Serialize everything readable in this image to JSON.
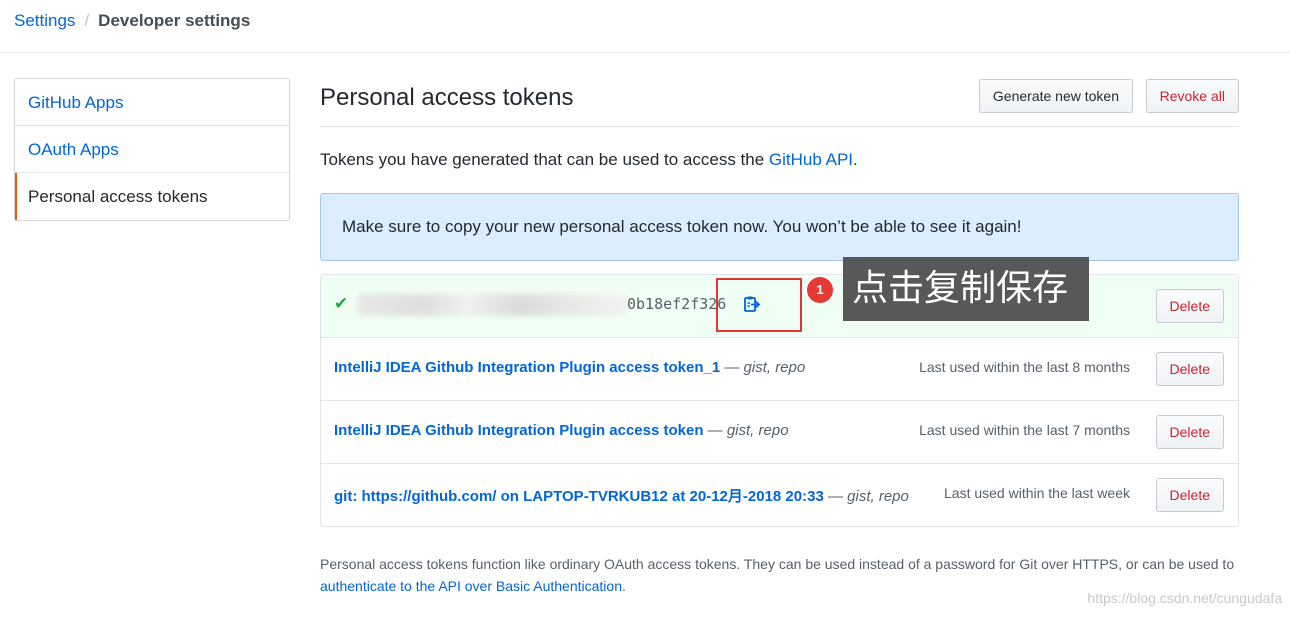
{
  "breadcrumb": {
    "parent": "Settings",
    "current": "Developer settings"
  },
  "sidebar": {
    "items": [
      {
        "label": "GitHub Apps"
      },
      {
        "label": "OAuth Apps"
      },
      {
        "label": "Personal access tokens",
        "selected": true
      }
    ]
  },
  "header": {
    "title": "Personal access tokens",
    "generate_button": "Generate new token",
    "revoke_button": "Revoke all"
  },
  "intro": {
    "text": "Tokens you have generated that can be used to access the ",
    "link": "GitHub API",
    "suffix": "."
  },
  "flash": {
    "message": "Make sure to copy your new personal access token now. You won’t be able to see it again!"
  },
  "new_token": {
    "visible_tail": "0b18ef2f326",
    "delete_label": "Delete",
    "annotation_number": "1",
    "annotation_text": "点击复制保存"
  },
  "tokens": [
    {
      "name": "IntelliJ IDEA Github Integration Plugin access token_1",
      "separator": "—",
      "scopes": "gist, repo",
      "last_used": "Last used within the last 8 months",
      "delete_label": "Delete"
    },
    {
      "name": "IntelliJ IDEA Github Integration Plugin access token",
      "separator": "—",
      "scopes": "gist, repo",
      "last_used": "Last used within the last 7 months",
      "delete_label": "Delete"
    },
    {
      "name": "git: https://github.com/ on LAPTOP-TVRKUB12 at 20-12月-2018 20:33",
      "separator": "—",
      "scopes": "gist, repo",
      "last_used": "Last used within the last week",
      "delete_label": "Delete"
    }
  ],
  "note": {
    "text": "Personal access tokens function like ordinary OAuth access tokens. They can be used instead of a password for Git over HTTPS, or can be used to ",
    "link": "authenticate to the API over Basic Authentication",
    "suffix": "."
  },
  "watermark": "https://blog.csdn.net/cungudafa",
  "colors": {
    "link": "#0366d6",
    "danger": "#cb2431",
    "success": "#28a745",
    "flash_bg": "#dbedff",
    "new_token_bg": "#f0fff4",
    "selected_accent": "#e36209",
    "annotation_red": "#e23232"
  },
  "icons": {
    "check": "check-icon",
    "copy": "clipboard-copy-icon"
  }
}
